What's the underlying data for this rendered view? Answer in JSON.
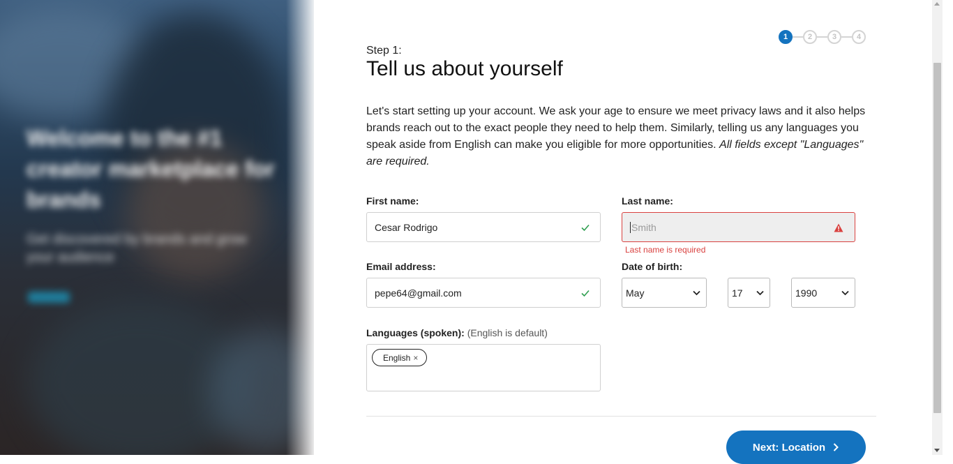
{
  "hero": {
    "headline": "Welcome to the #1 creator marketplace for brands",
    "subtext": "Get discovered by brands and grow your audience"
  },
  "stepper": {
    "steps": [
      "1",
      "2",
      "3",
      "4"
    ],
    "active_step": 1
  },
  "form": {
    "step_label": "Step 1:",
    "title": "Tell us about yourself",
    "intro_text": "Let's start setting up your account. We ask your age to ensure we meet privacy laws and it also helps brands reach out to the exact people they need to help them. Similarly, telling us any languages you speak aside from English can make you eligible for more opportunities. ",
    "intro_note": "All fields except \"Languages\" are required.",
    "first_name": {
      "label": "First name:",
      "value": "Cesar Rodrigo",
      "status": "valid"
    },
    "last_name": {
      "label": "Last name:",
      "value": "",
      "placeholder": "Smith",
      "status": "error",
      "error": "Last name is required"
    },
    "email": {
      "label": "Email address:",
      "value": "pepe64@gmail.com",
      "status": "valid"
    },
    "dob": {
      "label": "Date of birth:",
      "month": "May",
      "day": "17",
      "year": "1990"
    },
    "languages": {
      "label": "Languages (spoken):",
      "hint": "(English is default)",
      "tags": [
        {
          "label": "English",
          "remove": "×"
        }
      ]
    },
    "next_button": "Next: Location"
  },
  "colors": {
    "accent": "#1473bf",
    "error": "#d9413f",
    "valid": "#2e9e4f"
  }
}
